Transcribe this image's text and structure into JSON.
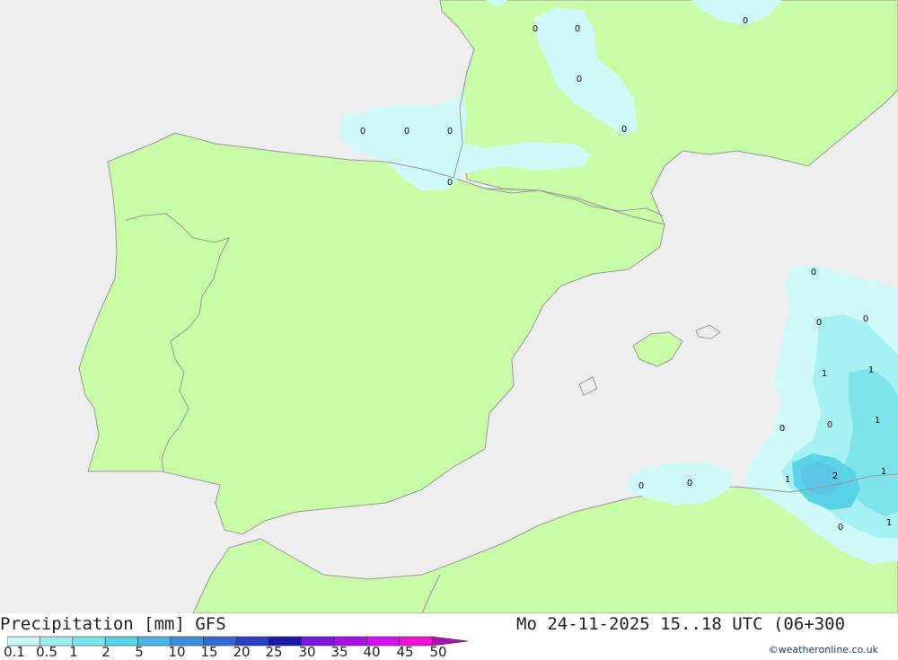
{
  "title": "Precipitation [mm] GFS",
  "datetime": "Mo 24-11-2025 15..18 UTC (06+300",
  "credit": "©weatheronline.co.uk",
  "legend": {
    "ticks": [
      "0.1",
      "0.5",
      "1",
      "2",
      "5",
      "10",
      "15",
      "20",
      "25",
      "30",
      "35",
      "40",
      "45",
      "50"
    ],
    "colors": [
      "#c8f7f7",
      "#9eeef0",
      "#78e5ea",
      "#5bd3e6",
      "#4cb6e3",
      "#3f8fdd",
      "#3566d4",
      "#2a3fc2",
      "#1b1aa6",
      "#7a16e0",
      "#a812e6",
      "#d40ef0",
      "#ee12d8",
      "#b010b0"
    ]
  },
  "colors": {
    "sea": "#eeeeee",
    "land": "#c8fca7",
    "precip_light": "#cff8f8",
    "precip_mid": "#a6f1f4",
    "precip_heavy": "#7fe3ec",
    "precip_peak": "#5bc6e6",
    "border": "#999999"
  },
  "map_values": [
    {
      "id": "v1",
      "text": "0"
    },
    {
      "id": "v2",
      "text": "0"
    },
    {
      "id": "v3",
      "text": "0"
    },
    {
      "id": "v4",
      "text": "0"
    },
    {
      "id": "v5",
      "text": "0"
    },
    {
      "id": "v6",
      "text": "0"
    },
    {
      "id": "v7",
      "text": "0"
    },
    {
      "id": "v8",
      "text": "0"
    },
    {
      "id": "v9",
      "text": "0"
    },
    {
      "id": "v10",
      "text": "0"
    },
    {
      "id": "v11",
      "text": "0"
    },
    {
      "id": "v12",
      "text": "0"
    },
    {
      "id": "v13",
      "text": "1"
    },
    {
      "id": "v14",
      "text": "1"
    },
    {
      "id": "v15",
      "text": "0"
    },
    {
      "id": "v16",
      "text": "0"
    },
    {
      "id": "v17",
      "text": "1"
    },
    {
      "id": "v18",
      "text": "1"
    },
    {
      "id": "v19",
      "text": "2"
    },
    {
      "id": "v20",
      "text": "1"
    },
    {
      "id": "v21",
      "text": "0"
    },
    {
      "id": "v22",
      "text": "0"
    },
    {
      "id": "v23",
      "text": "0"
    },
    {
      "id": "v24",
      "text": "1"
    }
  ]
}
